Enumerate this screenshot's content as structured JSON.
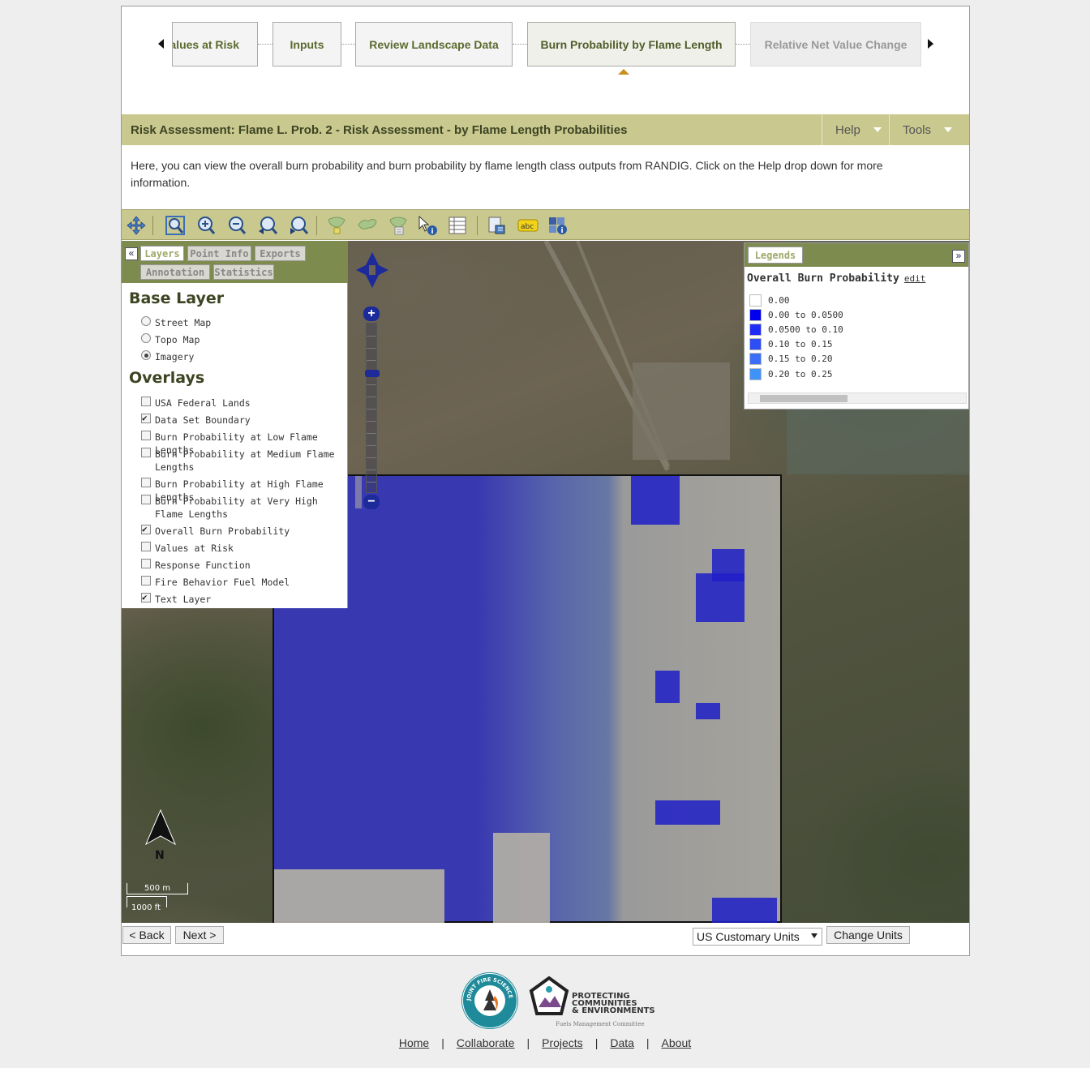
{
  "wizard": {
    "steps": [
      {
        "label": "Values at Risk",
        "state": "normal"
      },
      {
        "label": "Inputs",
        "state": "normal"
      },
      {
        "label": "Review Landscape Data",
        "state": "normal"
      },
      {
        "label": "Burn Probability by Flame Length",
        "state": "active"
      },
      {
        "label": "Relative Net Value Change",
        "state": "disabled"
      }
    ]
  },
  "header": {
    "title": "Risk Assessment: Flame L. Prob. 2 - Risk Assessment - by Flame Length Probabilities",
    "help_label": "Help",
    "tools_label": "Tools"
  },
  "description": "Here, you can view the overall burn probability and burn probability by flame length class outputs from RANDIG. Click on the Help drop down for more information.",
  "toolbar": {
    "tools": [
      "pan-icon",
      "zoom-extent-icon",
      "zoom-in-icon",
      "zoom-out-icon",
      "zoom-previous-icon",
      "zoom-next-icon",
      "select-polygon-icon",
      "select-area-icon",
      "clear-selection-icon",
      "identify-icon",
      "table-icon",
      "print-icon",
      "label-icon",
      "query-icon"
    ],
    "label_icon_text": "abc"
  },
  "left_panel": {
    "tabs": [
      {
        "label": "Layers",
        "active": true
      },
      {
        "label": "Point Info",
        "active": false
      },
      {
        "label": "Exports",
        "active": false
      },
      {
        "label": "Annotation",
        "active": false
      },
      {
        "label": "Statistics",
        "active": false
      }
    ],
    "base_layer_heading": "Base Layer",
    "base_layers": [
      {
        "label": "Street Map",
        "checked": false
      },
      {
        "label": "Topo Map",
        "checked": false
      },
      {
        "label": "Imagery",
        "checked": true
      }
    ],
    "overlays_heading": "Overlays",
    "overlays": [
      {
        "label": "USA Federal Lands",
        "checked": false
      },
      {
        "label": "Data Set Boundary",
        "checked": true
      },
      {
        "label": "Burn Probability at Low Flame Lengths",
        "checked": false
      },
      {
        "label": "Burn Probability at Medium Flame Lengths",
        "checked": false
      },
      {
        "label": "Burn Probability at High Flame Lengths",
        "checked": false
      },
      {
        "label": "Burn Probability at Very High Flame Lengths",
        "checked": false
      },
      {
        "label": "Overall Burn Probability",
        "checked": true
      },
      {
        "label": "Values at Risk",
        "checked": false
      },
      {
        "label": "Response Function",
        "checked": false
      },
      {
        "label": "Fire Behavior Fuel Model",
        "checked": false
      },
      {
        "label": "Text Layer",
        "checked": true
      }
    ]
  },
  "legend": {
    "tab_label": "Legends",
    "title": "Overall Burn Probability",
    "edit_label": "edit",
    "entries": [
      {
        "label": "0.00",
        "color": "#ffffff"
      },
      {
        "label": "0.00 to 0.0500",
        "color": "#0000ee"
      },
      {
        "label": "0.0500 to 0.10",
        "color": "#1e2cf5"
      },
      {
        "label": "0.10 to 0.15",
        "color": "#2d4df5"
      },
      {
        "label": "0.15 to 0.20",
        "color": "#3a6ef7"
      },
      {
        "label": "0.20 to 0.25",
        "color": "#3f92f7"
      }
    ]
  },
  "map": {
    "zoom_in": "+",
    "zoom_out": "−",
    "north_label": "N",
    "scale_metric": "500 m",
    "scale_imperial": "1000 ft"
  },
  "bottom": {
    "back_label": "< Back",
    "next_label": "Next >",
    "units_value": "US Customary Units",
    "change_units_label": "Change Units"
  },
  "footer": {
    "logo1_text": "JOINT FIRE SCIENCE PROGRAM",
    "logo2_line1": "PROTECTING",
    "logo2_line2": "COMMUNITIES",
    "logo2_line3": "& ENVIRONMENTS",
    "logo2_sub": "Fuels Management Committee",
    "links": [
      "Home",
      "Collaborate",
      "Projects",
      "Data",
      "About"
    ]
  }
}
